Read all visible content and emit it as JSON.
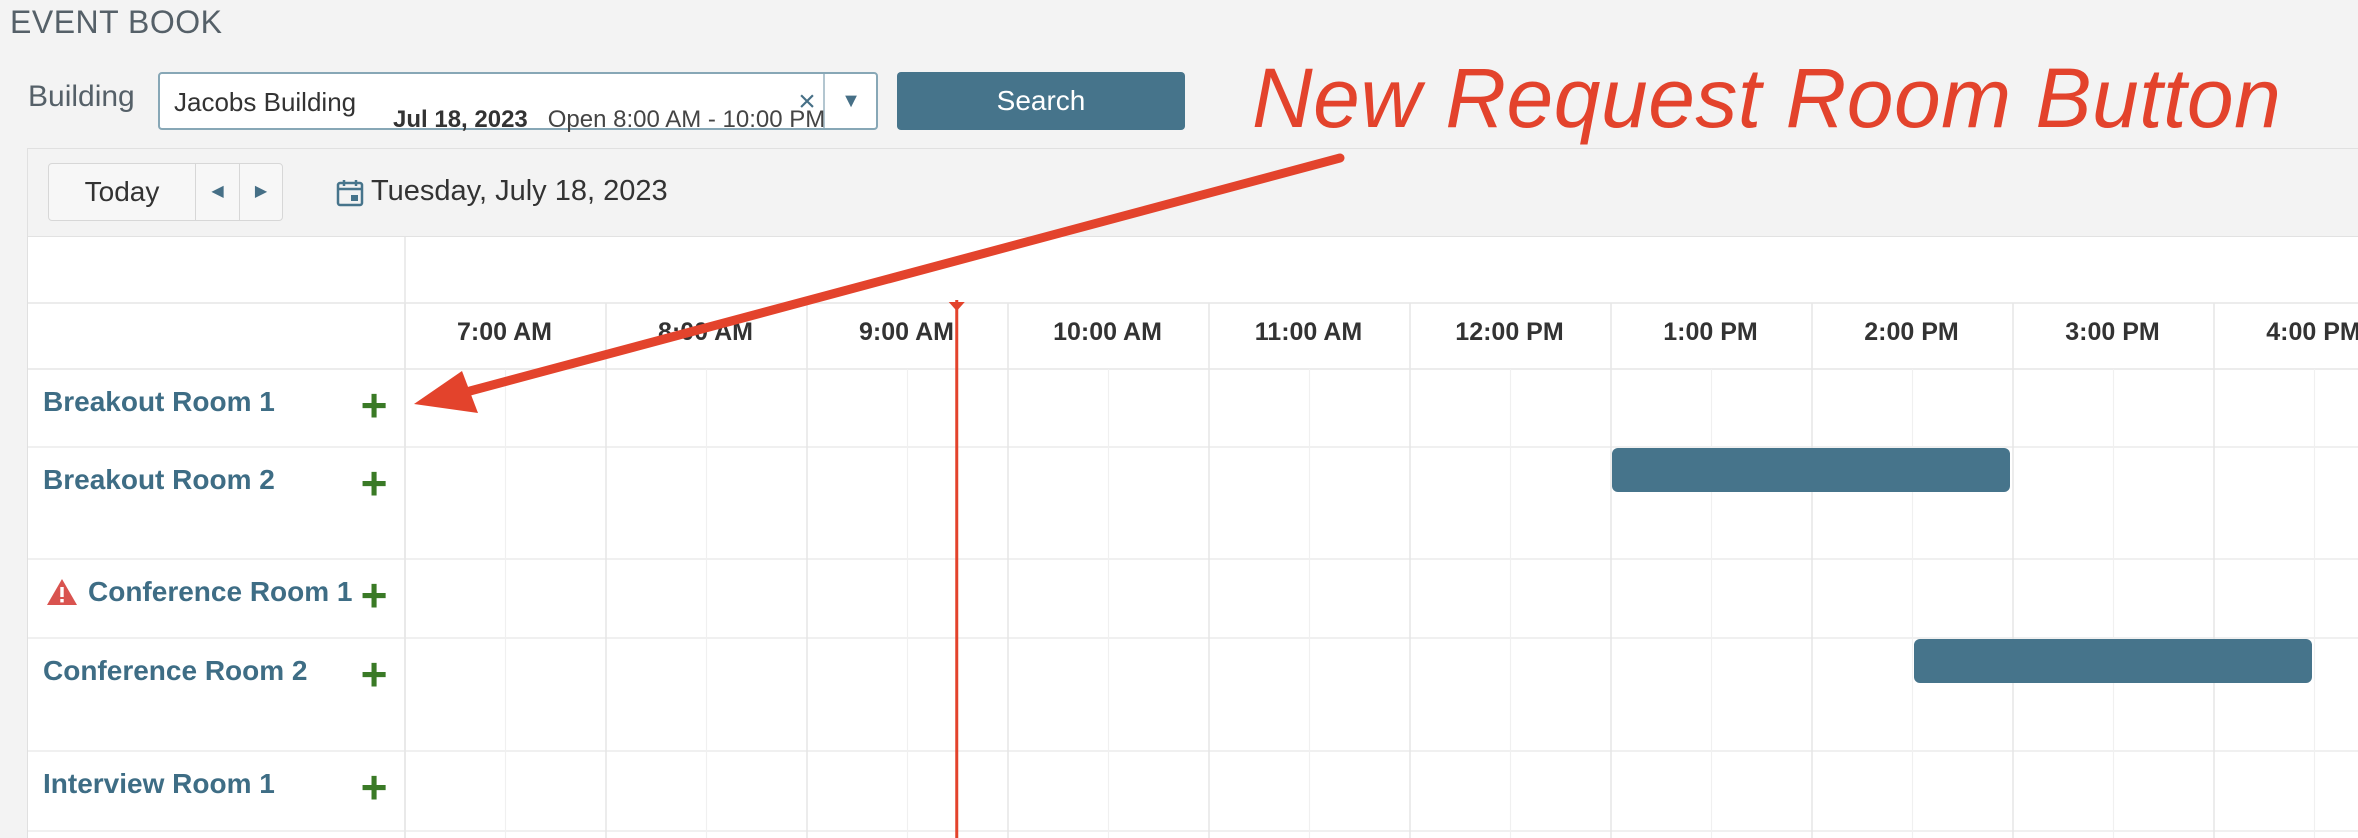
{
  "app": {
    "title": "EVENT BOOK"
  },
  "filter": {
    "building_label": "Building",
    "building_value": "Jacobs Building",
    "clear_glyph": "×",
    "caret_glyph": "▼",
    "search_label": "Search"
  },
  "toolbar": {
    "today_label": "Today",
    "prev_glyph": "◀",
    "next_glyph": "▶",
    "current_date": "Tuesday, July 18, 2023"
  },
  "schedule": {
    "date": "Jul 18, 2023",
    "open_hours": "Open 8:00 AM - 10:00 PM",
    "times": [
      "7:00 AM",
      "8:00 AM",
      "9:00 AM",
      "10:00 AM",
      "11:00 AM",
      "12:00 PM",
      "1:00 PM",
      "2:00 PM",
      "3:00 PM",
      "4:00 PM"
    ],
    "now_time": "9:45 AM",
    "rooms": [
      {
        "name": "Breakout Room 1",
        "warning": false
      },
      {
        "name": "Breakout Room 2",
        "warning": false
      },
      {
        "name": "Conference Room 1",
        "warning": true
      },
      {
        "name": "Conference Room 2",
        "warning": false
      },
      {
        "name": "Interview Room 1",
        "warning": false
      }
    ],
    "events": [
      {
        "room": "Breakout Room 2",
        "start": "1:00 PM",
        "end": "3:00 PM"
      },
      {
        "room": "Conference Room 2",
        "start": "2:30 PM",
        "end": "4:30 PM"
      }
    ],
    "add_glyph": "+"
  },
  "annotation": {
    "text": "New Request Room Button",
    "color": "#e3432c"
  },
  "colors": {
    "accent": "#46748b",
    "room_name": "#3e6d85",
    "add_icon": "#3a7a26",
    "now_line": "#e3432c",
    "warning": "#d9534f"
  },
  "icons": {
    "calendar": "calendar-icon",
    "warning": "warning-triangle-icon",
    "add": "plus-icon",
    "clear": "close-icon",
    "dropdown": "chevron-down-icon"
  }
}
